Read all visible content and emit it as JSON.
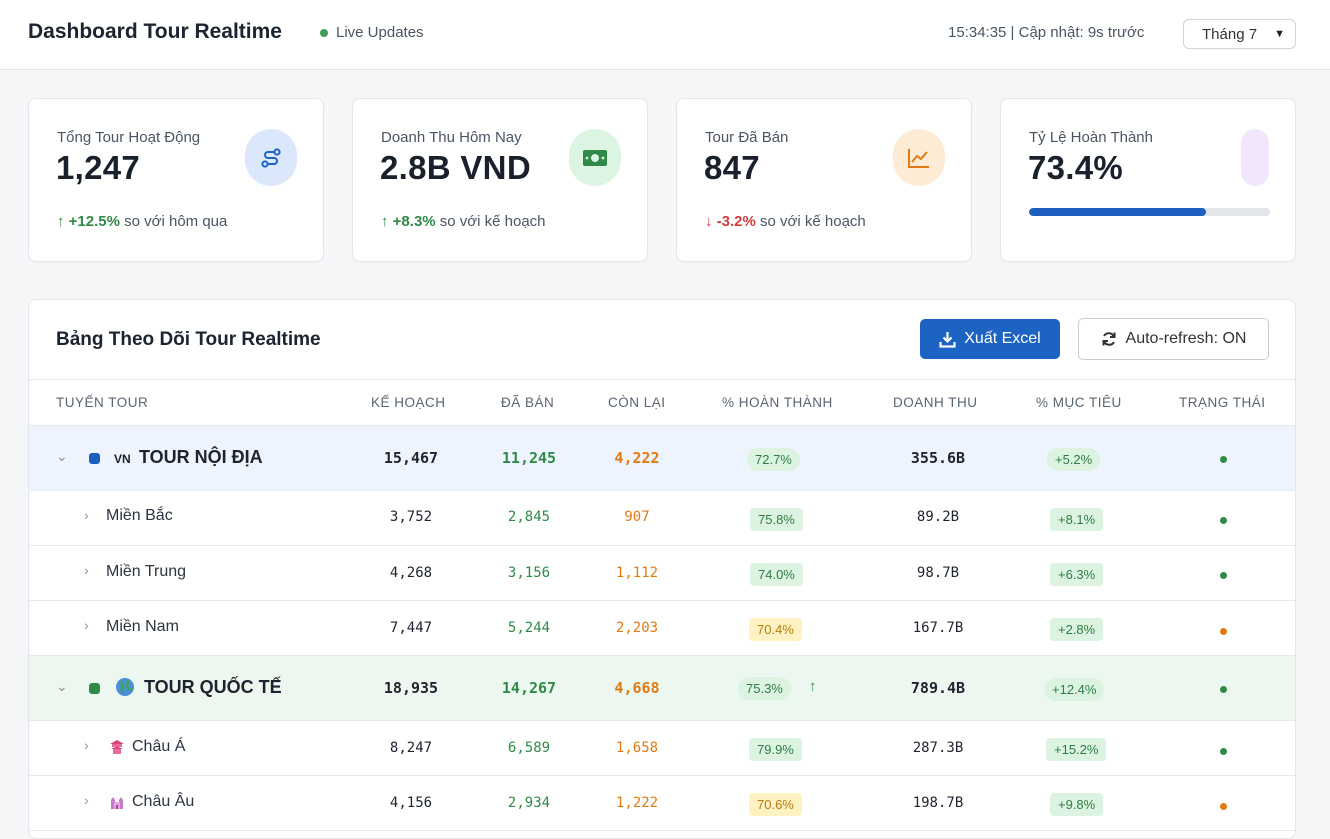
{
  "header": {
    "title": "Dashboard Tour Realtime",
    "live_label": "Live Updates",
    "time_text": "15:34:35 | Cập nhật: 9s trước",
    "month_selected": "Tháng 7"
  },
  "kpis": [
    {
      "label": "Tổng Tour Hoạt Động",
      "value": "1,247",
      "delta": "+12.5%",
      "delta_text": "so với hôm qua",
      "direction": "up",
      "icon": "route-icon",
      "icon_bg": "#dbe8fb"
    },
    {
      "label": "Doanh Thu Hôm Nay",
      "value": "2.8B VND",
      "delta": "+8.3%",
      "delta_text": "so với kế hoạch",
      "direction": "up",
      "icon": "money-icon",
      "icon_bg": "#dcf4e2"
    },
    {
      "label": "Tour Đã Bán",
      "value": "847",
      "delta": "-3.2%",
      "delta_text": "so với kế hoạch",
      "direction": "down",
      "icon": "chart-line-icon",
      "icon_bg": "#fdebd6"
    },
    {
      "label": "Tỷ Lệ Hoàn Thành",
      "value": "73.4%",
      "progress": 0.734,
      "icon": "target-icon",
      "icon_bg": "#f1e6fb"
    }
  ],
  "table": {
    "title": "Bảng Theo Dõi Tour Realtime",
    "export_label": "Xuất Excel",
    "refresh_label": "Auto-refresh: ON",
    "columns": [
      "Tuyến Tour",
      "Kế Hoạch",
      "Đã Bán",
      "Còn Lại",
      "% Hoàn Thành",
      "Doanh Thu",
      "% Mục Tiêu",
      "Trạng Thái"
    ],
    "rows": [
      {
        "kind": "group",
        "theme": "dom",
        "flag": "VN",
        "name": "TOUR NỘI ĐỊA",
        "plan": "15,467",
        "sold": "11,245",
        "left": "4,222",
        "pct": "72.7%",
        "rev": "355.6B",
        "target": "+5.2%",
        "status": "green"
      },
      {
        "kind": "sub",
        "name": "Miền Bắc",
        "plan": "3,752",
        "sold": "2,845",
        "left": "907",
        "pct": "75.8%",
        "pct_color": "green",
        "rev": "89.2B",
        "target": "+8.1%",
        "status": "green"
      },
      {
        "kind": "sub",
        "name": "Miền Trung",
        "plan": "4,268",
        "sold": "3,156",
        "left": "1,112",
        "pct": "74.0%",
        "pct_color": "green",
        "rev": "98.7B",
        "target": "+6.3%",
        "status": "green"
      },
      {
        "kind": "sub",
        "name": "Miền Nam",
        "plan": "7,447",
        "sold": "5,244",
        "left": "2,203",
        "pct": "70.4%",
        "pct_color": "yellow",
        "rev": "167.7B",
        "target": "+2.8%",
        "status": "orange"
      },
      {
        "kind": "group",
        "theme": "intl",
        "flag": "globe",
        "name": "TOUR QUỐC TẾ",
        "plan": "18,935",
        "sold": "14,267",
        "left": "4,668",
        "pct": "75.3%",
        "rev": "789.4B",
        "target": "+12.4%",
        "status": "green",
        "trend": "up"
      },
      {
        "kind": "sub",
        "icon": "pagoda-icon",
        "name": "Châu Á",
        "plan": "8,247",
        "sold": "6,589",
        "left": "1,658",
        "pct": "79.9%",
        "pct_color": "green",
        "rev": "287.3B",
        "target": "+15.2%",
        "status": "green"
      },
      {
        "kind": "sub",
        "icon": "castle-icon",
        "name": "Châu Âu",
        "plan": "4,156",
        "sold": "2,934",
        "left": "1,222",
        "pct": "70.6%",
        "pct_color": "yellow",
        "rev": "198.7B",
        "target": "+9.8%",
        "status": "orange"
      }
    ]
  },
  "colors": {
    "brand_blue": "#1d63c4",
    "green": "#2f8a47",
    "orange": "#e07b14",
    "red": "#d13c3c"
  }
}
